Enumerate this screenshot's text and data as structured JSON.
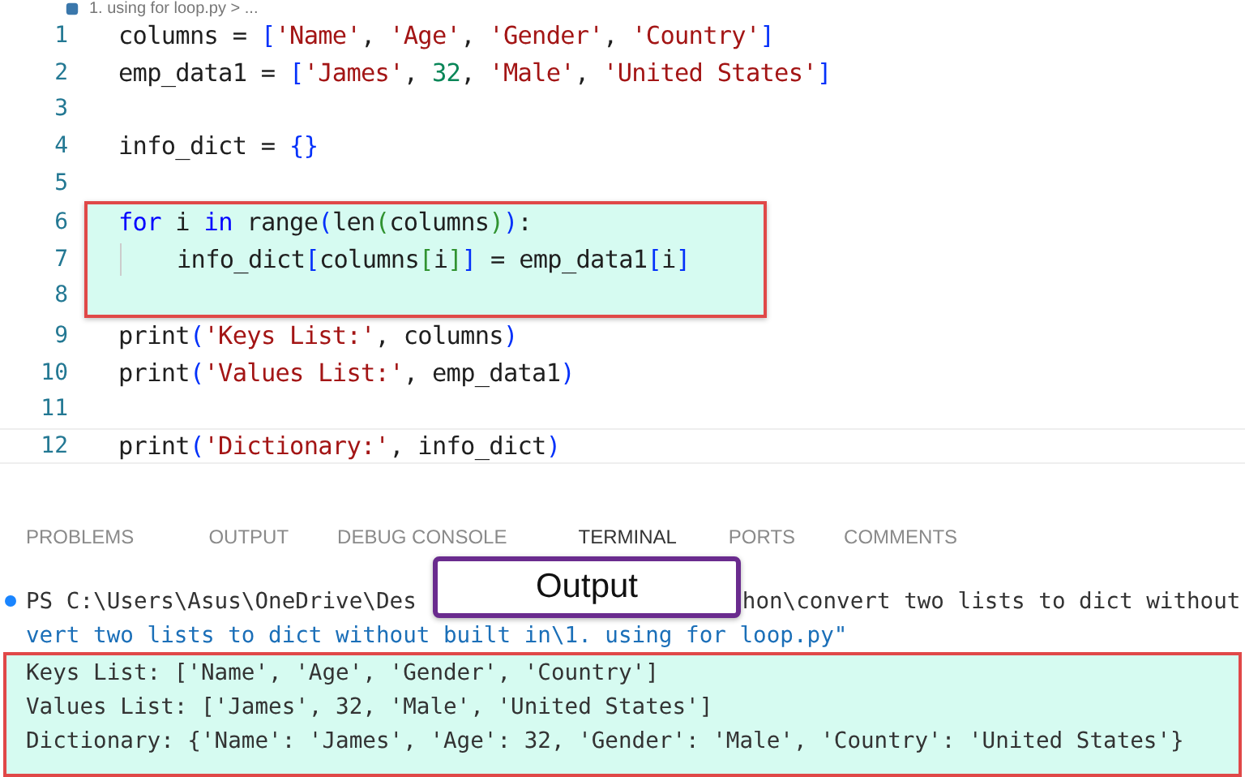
{
  "breadcrumb": {
    "text": "1. using for loop.py > ..."
  },
  "code": {
    "lines": [
      {
        "number": "1",
        "highlighted": false,
        "current": false,
        "indent_guide": false,
        "tokens": [
          {
            "text": "columns = ",
            "kind": "plain"
          },
          {
            "text": "[",
            "kind": "bracket"
          },
          {
            "text": "'Name'",
            "kind": "str"
          },
          {
            "text": ", ",
            "kind": "plain"
          },
          {
            "text": "'Age'",
            "kind": "str"
          },
          {
            "text": ", ",
            "kind": "plain"
          },
          {
            "text": "'Gender'",
            "kind": "str"
          },
          {
            "text": ", ",
            "kind": "plain"
          },
          {
            "text": "'Country'",
            "kind": "str"
          },
          {
            "text": "]",
            "kind": "bracket"
          }
        ]
      },
      {
        "number": "2",
        "highlighted": false,
        "current": false,
        "indent_guide": false,
        "tokens": [
          {
            "text": "emp_data1 = ",
            "kind": "plain"
          },
          {
            "text": "[",
            "kind": "bracket"
          },
          {
            "text": "'James'",
            "kind": "str"
          },
          {
            "text": ", ",
            "kind": "plain"
          },
          {
            "text": "32",
            "kind": "num"
          },
          {
            "text": ", ",
            "kind": "plain"
          },
          {
            "text": "'Male'",
            "kind": "str"
          },
          {
            "text": ", ",
            "kind": "plain"
          },
          {
            "text": "'United States'",
            "kind": "str"
          },
          {
            "text": "]",
            "kind": "bracket"
          }
        ]
      },
      {
        "number": "3",
        "highlighted": false,
        "current": false,
        "indent_guide": false
      },
      {
        "number": "4",
        "highlighted": false,
        "current": false,
        "indent_guide": false,
        "tokens": [
          {
            "text": "info_dict = ",
            "kind": "plain"
          },
          {
            "text": "{}",
            "kind": "bracket"
          }
        ]
      },
      {
        "number": "5",
        "highlighted": false,
        "current": false,
        "indent_guide": false
      },
      {
        "number": "6",
        "highlighted": true,
        "current": false,
        "indent_guide": false,
        "tokens": [
          {
            "text": "for",
            "kind": "kw"
          },
          {
            "text": " i ",
            "kind": "plain"
          },
          {
            "text": "in",
            "kind": "kw"
          },
          {
            "text": " range",
            "kind": "plain"
          },
          {
            "text": "(",
            "kind": "bracket"
          },
          {
            "text": "len",
            "kind": "plain"
          },
          {
            "text": "(",
            "kind": "paren2"
          },
          {
            "text": "columns",
            "kind": "plain"
          },
          {
            "text": ")",
            "kind": "paren2"
          },
          {
            "text": ")",
            "kind": "bracket"
          },
          {
            "text": ":",
            "kind": "plain"
          }
        ]
      },
      {
        "number": "7",
        "highlighted": true,
        "current": false,
        "indent_guide": true,
        "tokens": [
          {
            "text": "info_dict",
            "kind": "plain"
          },
          {
            "text": "[",
            "kind": "bracket"
          },
          {
            "text": "columns",
            "kind": "plain"
          },
          {
            "text": "[",
            "kind": "paren2"
          },
          {
            "text": "i",
            "kind": "plain"
          },
          {
            "text": "]",
            "kind": "paren2"
          },
          {
            "text": "]",
            "kind": "bracket"
          },
          {
            "text": " = emp_data1",
            "kind": "plain"
          },
          {
            "text": "[",
            "kind": "bracket"
          },
          {
            "text": "i",
            "kind": "plain"
          },
          {
            "text": "]",
            "kind": "bracket"
          }
        ]
      },
      {
        "number": "8",
        "highlighted": true,
        "current": false,
        "indent_guide": false
      },
      {
        "number": "9",
        "highlighted": false,
        "current": false,
        "indent_guide": false,
        "tokens": [
          {
            "text": "print",
            "kind": "plain"
          },
          {
            "text": "(",
            "kind": "bracket"
          },
          {
            "text": "'Keys List:'",
            "kind": "str"
          },
          {
            "text": ", columns",
            "kind": "plain"
          },
          {
            "text": ")",
            "kind": "bracket"
          }
        ]
      },
      {
        "number": "10",
        "highlighted": false,
        "current": false,
        "indent_guide": false,
        "tokens": [
          {
            "text": "print",
            "kind": "plain"
          },
          {
            "text": "(",
            "kind": "bracket"
          },
          {
            "text": "'Values List:'",
            "kind": "str"
          },
          {
            "text": ", emp_data1",
            "kind": "plain"
          },
          {
            "text": ")",
            "kind": "bracket"
          }
        ]
      },
      {
        "number": "11",
        "highlighted": false,
        "current": false,
        "indent_guide": false
      },
      {
        "number": "12",
        "highlighted": false,
        "current": true,
        "indent_guide": false,
        "tokens": [
          {
            "text": "print",
            "kind": "plain"
          },
          {
            "text": "(",
            "kind": "bracket"
          },
          {
            "text": "'Dictionary:'",
            "kind": "str"
          },
          {
            "text": ", info_dict",
            "kind": "plain"
          },
          {
            "text": ")",
            "kind": "bracket"
          }
        ]
      }
    ]
  },
  "panel": {
    "tabs": [
      {
        "label": "PROBLEMS",
        "selected": false
      },
      {
        "label": "OUTPUT",
        "selected": false
      },
      {
        "label": "DEBUG CONSOLE",
        "selected": false
      },
      {
        "label": "TERMINAL",
        "selected": true
      },
      {
        "label": "PORTS",
        "selected": false
      },
      {
        "label": "COMMENTS",
        "selected": false
      }
    ],
    "callout": {
      "text": "Output"
    },
    "terminal": [
      {
        "kind": "prompt",
        "highlighted": false,
        "parts": [
          "PS C:\\Users\\Asus\\OneDrive\\Des",
          "hon\\convert two lists to dict without"
        ]
      },
      {
        "kind": "path",
        "highlighted": false,
        "parts": [
          "vert two lists to dict without built in\\1. using for loop.py\""
        ]
      },
      {
        "kind": "output",
        "highlighted": true,
        "parts": [
          "Keys List: ['Name', 'Age', 'Gender', 'Country']"
        ]
      },
      {
        "kind": "output",
        "highlighted": true,
        "parts": [
          "Values List: ['James', 32, 'Male', 'United States']"
        ]
      },
      {
        "kind": "output",
        "highlighted": true,
        "parts": [
          "Dictionary: {'Name': 'James', 'Age': 32, 'Gender': 'Male', 'Country': 'United States'}"
        ]
      }
    ]
  }
}
